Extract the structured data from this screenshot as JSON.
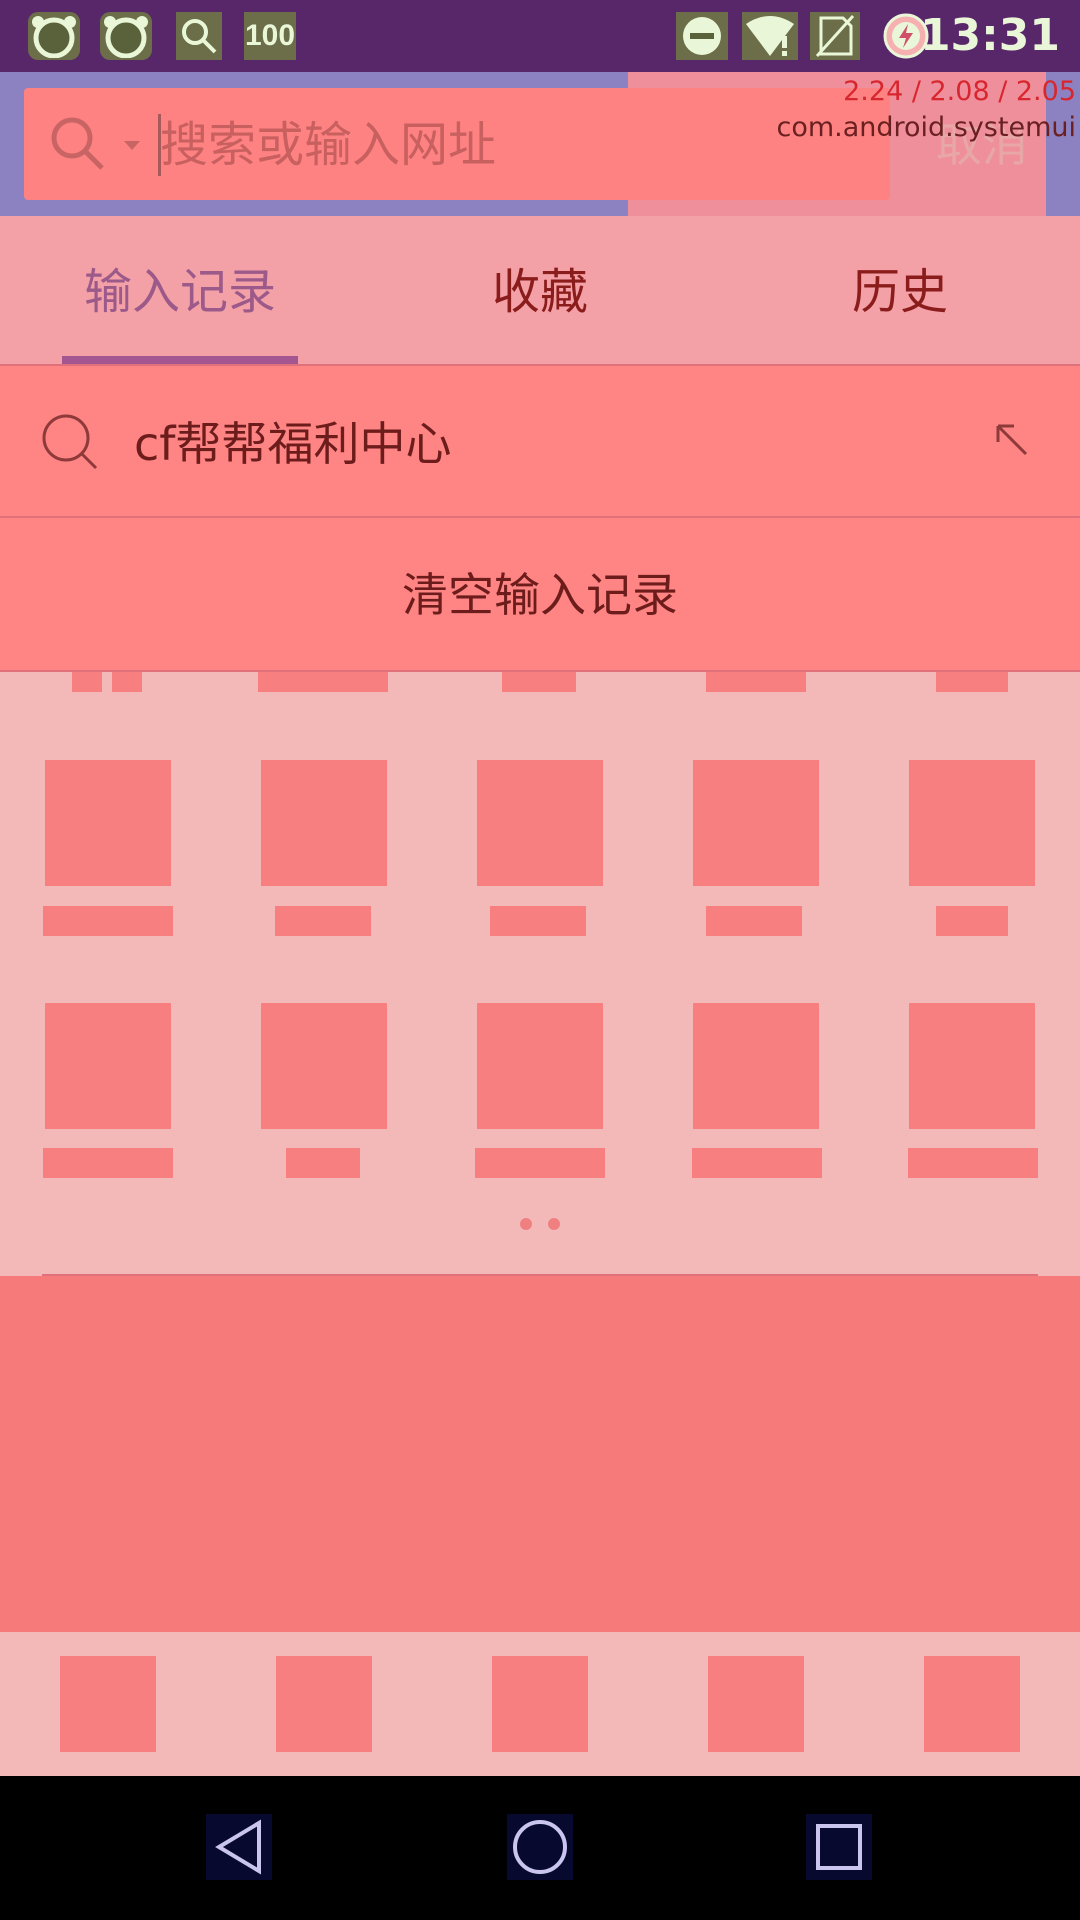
{
  "status_bar": {
    "time": "13:31",
    "left_icons": [
      "cat-icon",
      "cat-icon",
      "search-icon",
      "battery-100-icon"
    ],
    "battery_label": "100",
    "right_icons": [
      "dnd-icon",
      "wifi-alert-icon",
      "no-sim-icon",
      "charging-icon"
    ]
  },
  "debug_overlay": {
    "line1": "2.24 / 2.08 / 2.05",
    "line2": "com.android.systemui"
  },
  "search": {
    "placeholder": "搜索或输入网址",
    "cancel_label": "取消"
  },
  "tabs": [
    {
      "label": "输入记录",
      "active": true
    },
    {
      "label": "收藏",
      "active": false
    },
    {
      "label": "历史",
      "active": false
    }
  ],
  "history": {
    "items": [
      {
        "text": "cf帮帮福利中心"
      }
    ],
    "clear_label": "清空输入记录"
  },
  "pager": {
    "pages": 2
  },
  "colors": {
    "status_bar": "#58276a",
    "header": "#8d82c1",
    "row": "#ff8484",
    "indicator": "#a3568f"
  }
}
